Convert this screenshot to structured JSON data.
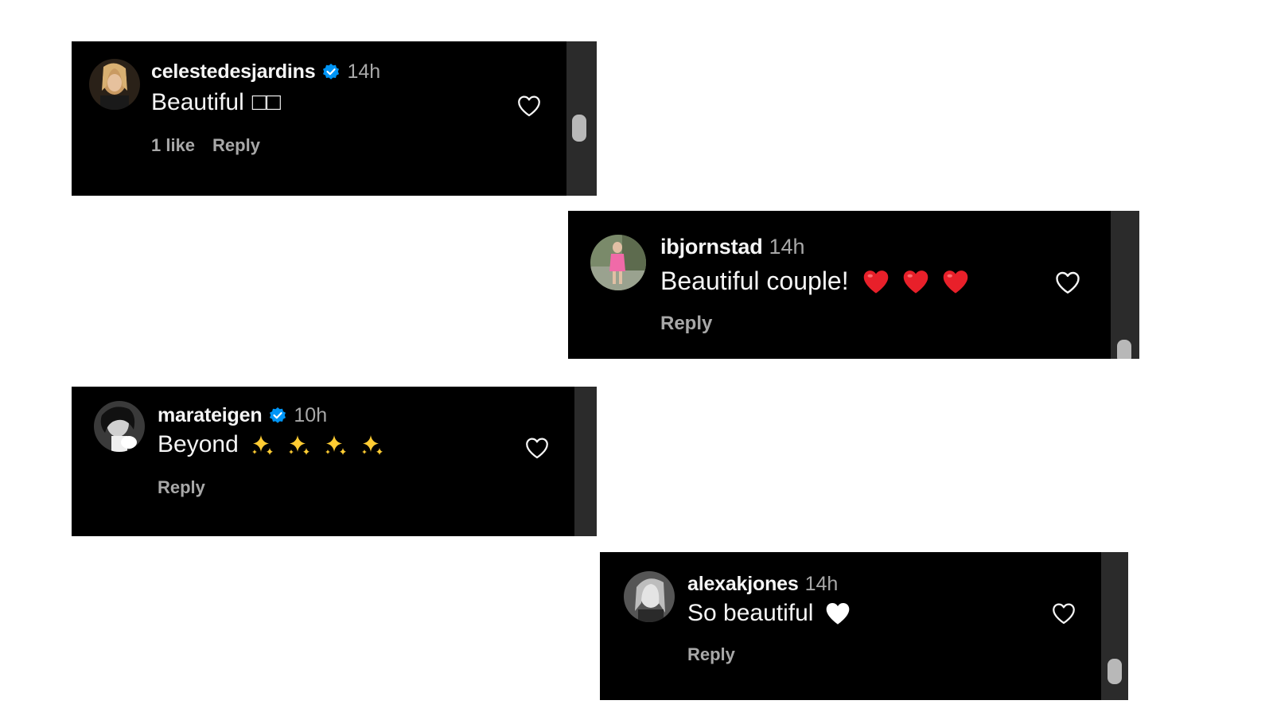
{
  "comments": [
    {
      "username": "celestedesjardins",
      "verified": true,
      "time": "14h",
      "text": "Beautiful",
      "emoji_glyphs": "□□",
      "likes_label": "1 like",
      "reply_label": "Reply"
    },
    {
      "username": "ibjornstad",
      "verified": false,
      "time": "14h",
      "text": "Beautiful couple!",
      "emoji_icons": [
        "red-heart-icon",
        "red-heart-icon",
        "red-heart-icon"
      ],
      "reply_label": "Reply"
    },
    {
      "username": "marateigen",
      "verified": true,
      "time": "10h",
      "text": "Beyond",
      "emoji_icons": [
        "sparkles-icon",
        "sparkles-icon",
        "sparkles-icon",
        "sparkles-icon"
      ],
      "reply_label": "Reply"
    },
    {
      "username": "alexakjones",
      "verified": false,
      "time": "14h",
      "text": "So beautiful",
      "emoji_icons": [
        "white-heart-icon"
      ],
      "reply_label": "Reply"
    }
  ],
  "colors": {
    "card_bg": "#000000",
    "username": "#f5f5f5",
    "secondary_text": "#a8a8a8",
    "verified_badge": "#0095f6",
    "red_heart": "#e8202a",
    "sparkle": "#ffcc33",
    "scroll_track": "#2b2b2b"
  }
}
